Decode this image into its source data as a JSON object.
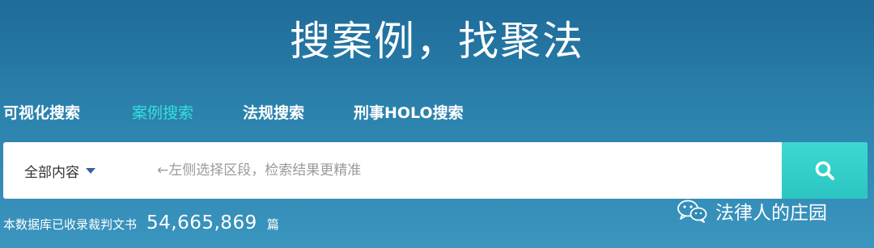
{
  "header": {
    "title": "搜案例，找聚法"
  },
  "tabs": [
    {
      "label": "可视化搜索",
      "active": false
    },
    {
      "label": "案例搜索",
      "active": true
    },
    {
      "label": "法规搜索",
      "active": false
    },
    {
      "label": "刑事HOLO搜索",
      "active": false
    }
  ],
  "search": {
    "scope_label": "全部内容",
    "placeholder": "←左侧选择区段，检索结果更精准",
    "button_icon": "search-icon"
  },
  "stats": {
    "label": "本数据库已收录裁判文书",
    "count": "54,665,869",
    "unit": "篇"
  },
  "watermark": {
    "icon": "wechat-icon",
    "text": "法律人的庄园"
  },
  "colors": {
    "background_top": "#1f6b99",
    "background_bottom": "#3a95bf",
    "active_tab": "#35e0de",
    "search_button": "#2cc6c2"
  }
}
